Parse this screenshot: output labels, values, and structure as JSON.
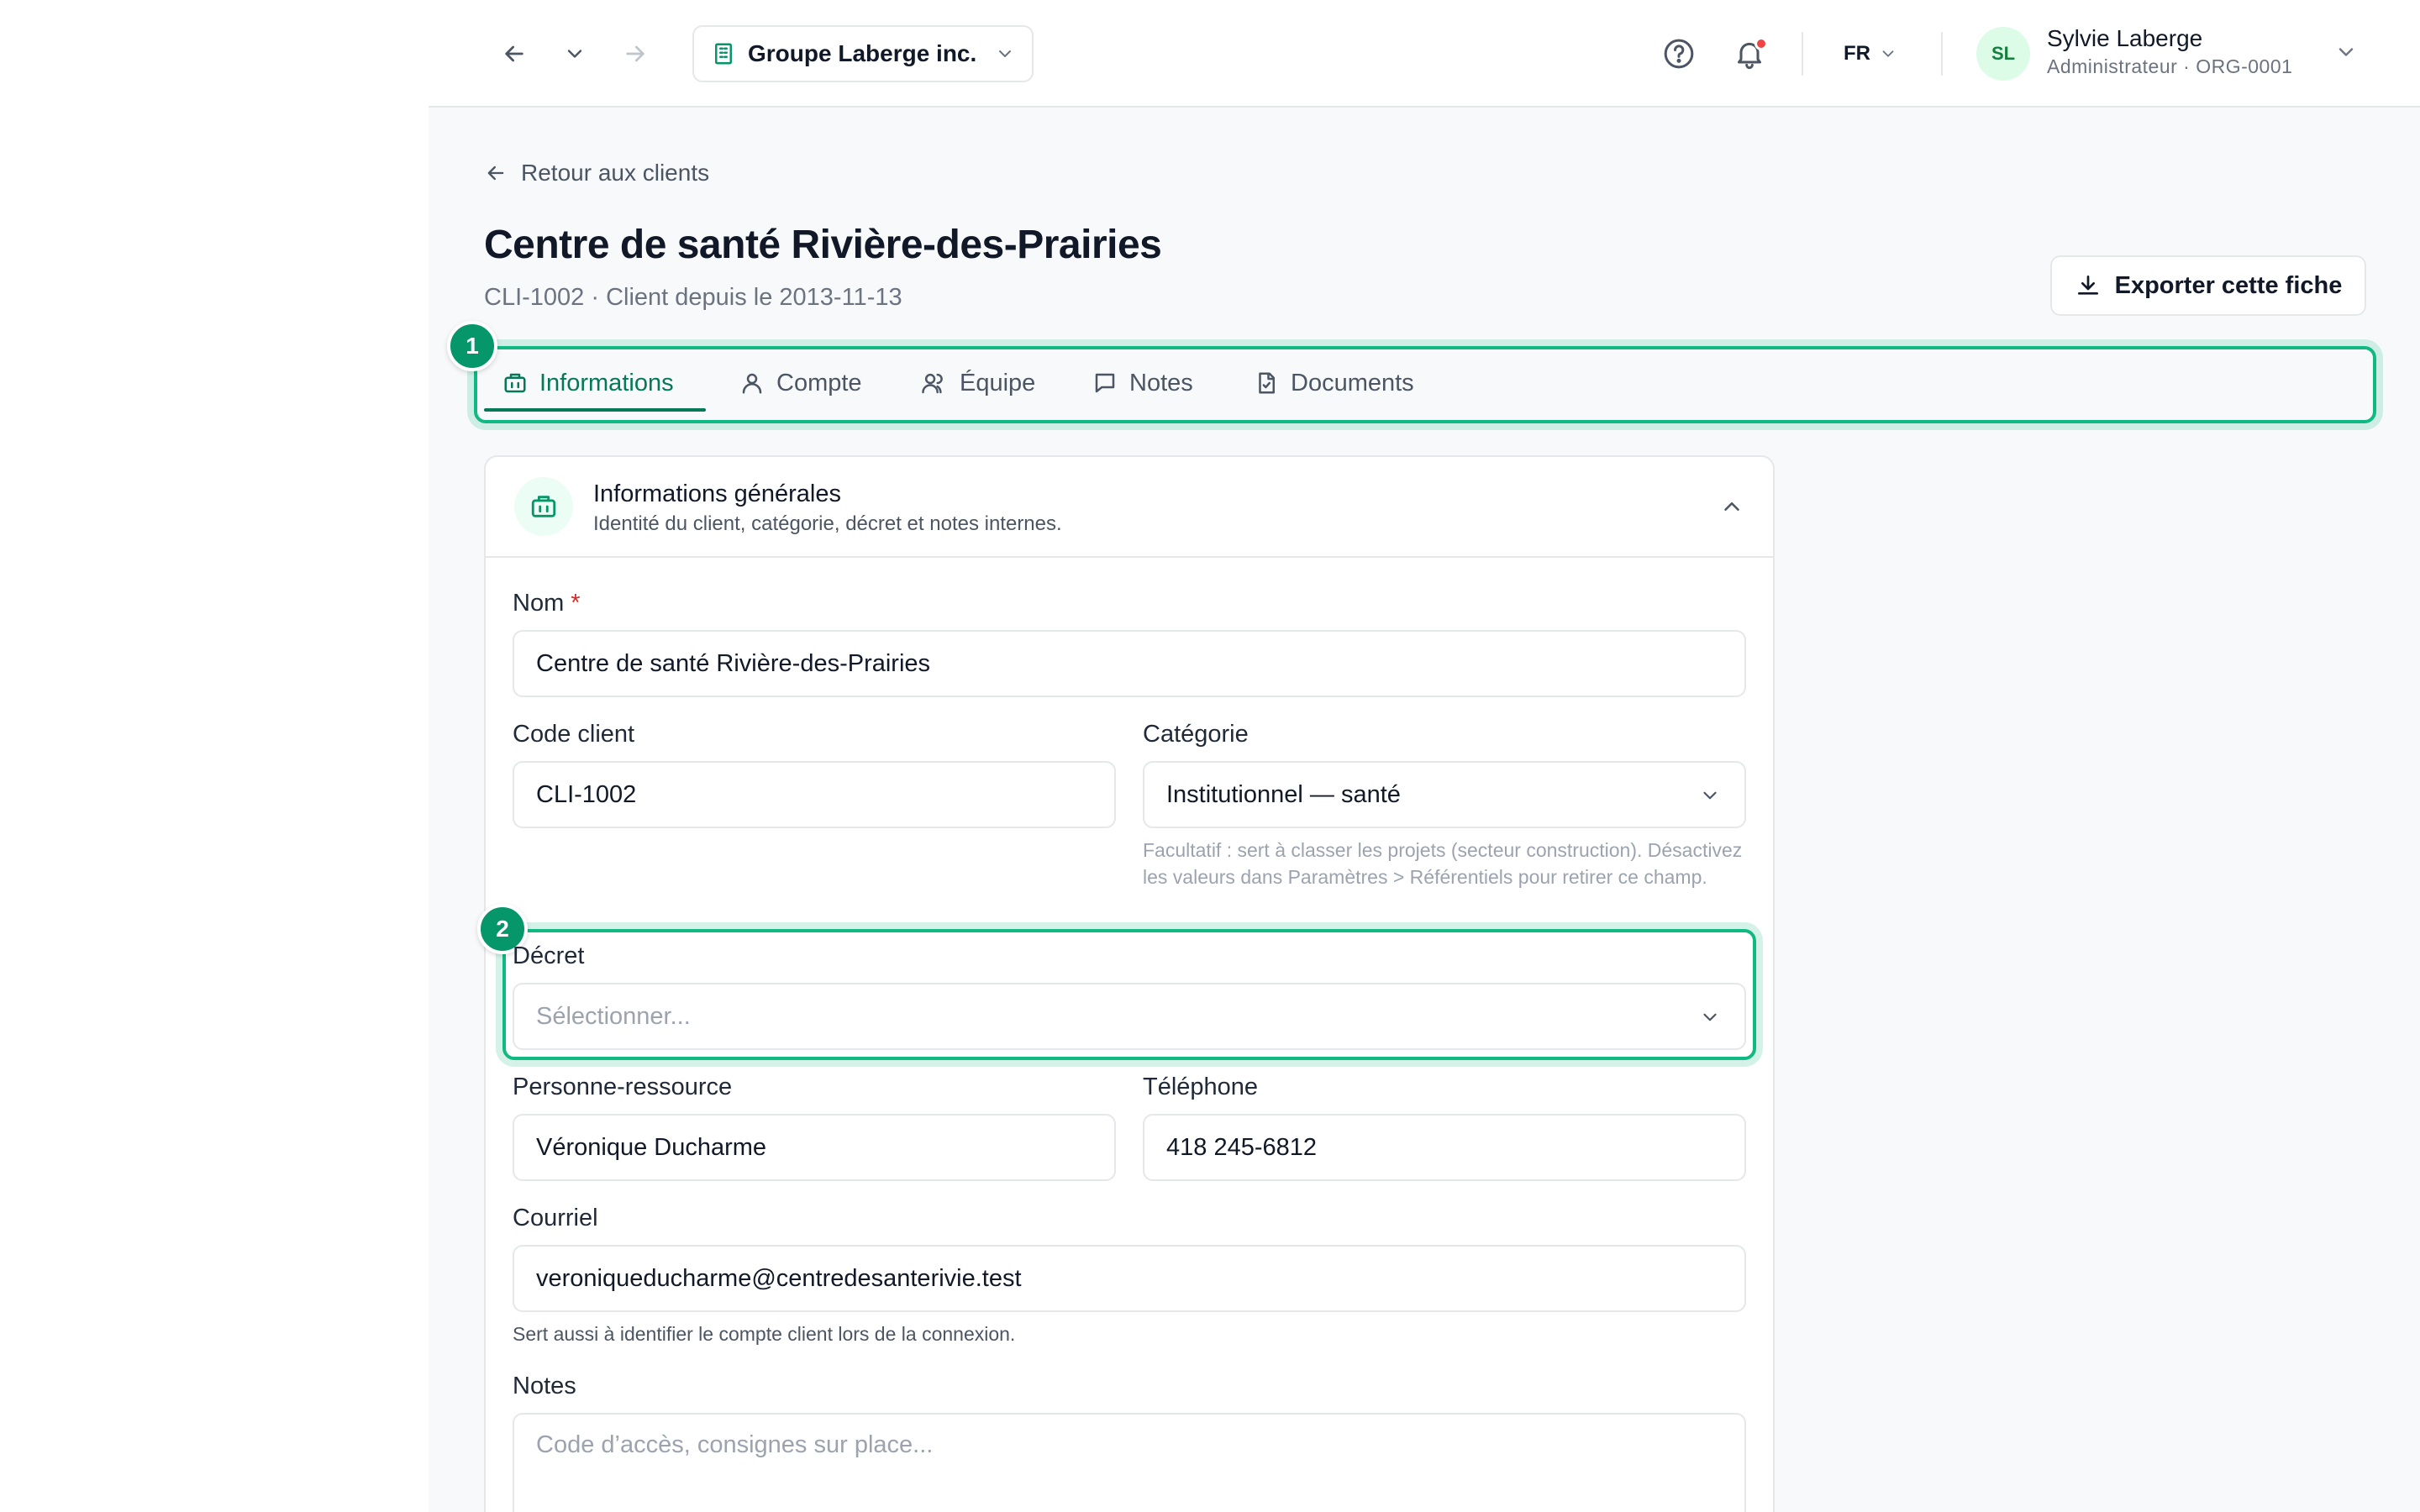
{
  "topbar": {
    "org_name": "Groupe Laberge inc.",
    "lang": "FR",
    "user": {
      "initials": "SL",
      "name": "Sylvie Laberge",
      "role": "Administrateur · ORG-0001"
    }
  },
  "page": {
    "back_label": "Retour aux clients",
    "title": "Centre de santé Rivière-des-Prairies",
    "subtitle": "CLI-1002 · Client depuis le 2013-11-13",
    "export_label": "Exporter cette fiche"
  },
  "tabs": [
    {
      "label": "Informations",
      "icon": "building-icon",
      "active": true
    },
    {
      "label": "Compte",
      "icon": "user-icon",
      "active": false
    },
    {
      "label": "Équipe",
      "icon": "users-icon",
      "active": false
    },
    {
      "label": "Notes",
      "icon": "message-icon",
      "active": false
    },
    {
      "label": "Documents",
      "icon": "document-icon",
      "active": false
    }
  ],
  "steps": {
    "one": "1",
    "two": "2"
  },
  "card": {
    "title": "Informations générales",
    "description": "Identité du client, catégorie, décret et notes internes."
  },
  "form": {
    "nom": {
      "label": "Nom",
      "required_mark": "*",
      "value": "Centre de santé Rivière-des-Prairies"
    },
    "code_client": {
      "label": "Code client",
      "value": "CLI-1002"
    },
    "categorie": {
      "label": "Catégorie",
      "value": "Institutionnel — santé",
      "help": "Facultatif : sert à classer les projets (secteur construction). Désactivez les valeurs dans Paramètres > Référentiels pour retirer ce champ."
    },
    "decret": {
      "label": "Décret",
      "placeholder": "Sélectionner..."
    },
    "personne_ressource": {
      "label": "Personne-ressource",
      "value": "Véronique Ducharme"
    },
    "telephone": {
      "label": "Téléphone",
      "value": "418 245-6812"
    },
    "courriel": {
      "label": "Courriel",
      "value": "veroniqueducharme@centredesanterivie.test",
      "help": "Sert aussi à identifier le compte client lors de la connexion."
    },
    "notes": {
      "label": "Notes",
      "placeholder": "Code d’accès, consignes sur place..."
    }
  },
  "colors": {
    "accent": "#047857",
    "highlight": "#10b981",
    "required": "#dc2626",
    "notification": "#ef4444"
  }
}
